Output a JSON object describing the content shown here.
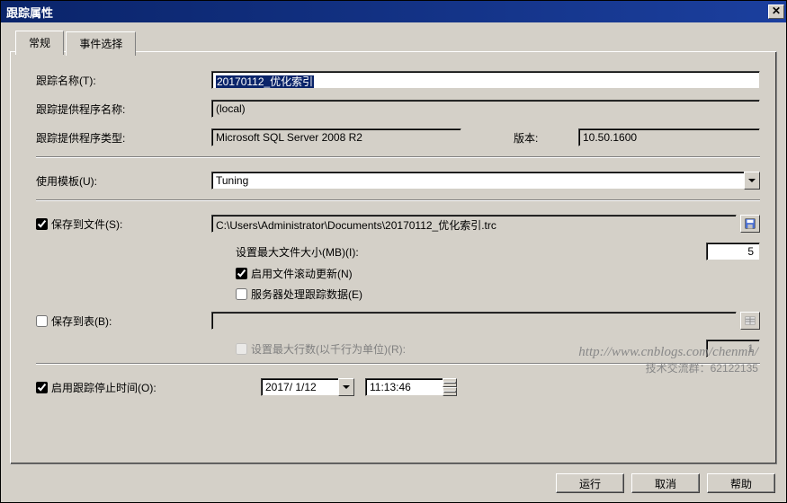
{
  "window": {
    "title": "跟踪属性"
  },
  "tabs": {
    "general": "常规",
    "events": "事件选择"
  },
  "labels": {
    "trace_name": "跟踪名称(T):",
    "provider_name": "跟踪提供程序名称:",
    "provider_type": "跟踪提供程序类型:",
    "version": "版本:",
    "use_template": "使用模板(U):",
    "save_to_file": "保存到文件(S):",
    "max_file_size": "设置最大文件大小(MB)(I):",
    "enable_rollover": "启用文件滚动更新(N)",
    "server_process": "服务器处理跟踪数据(E)",
    "save_to_table": "保存到表(B):",
    "max_rows": "设置最大行数(以千行为单位)(R):",
    "enable_stop": "启用跟踪停止时间(O):"
  },
  "values": {
    "trace_name": "20170112_优化索引",
    "provider_name": "(local)",
    "provider_type": "Microsoft SQL Server 2008 R2",
    "version": "10.50.1600",
    "template": "Tuning",
    "file_path": "C:\\Users\\Administrator\\Documents\\20170112_优化索引.trc",
    "max_file_size": "5",
    "max_rows": "1",
    "stop_date": "2017/ 1/12",
    "stop_time": "11:13:46"
  },
  "checkboxes": {
    "save_to_file": true,
    "enable_rollover": true,
    "server_process": false,
    "save_to_table": false,
    "max_rows": false,
    "enable_stop": true
  },
  "buttons": {
    "run": "运行",
    "cancel": "取消",
    "help": "帮助"
  },
  "watermark": {
    "url": "http://www.cnblogs.com/chenmh/",
    "qq": "技术交流群：62122135"
  }
}
